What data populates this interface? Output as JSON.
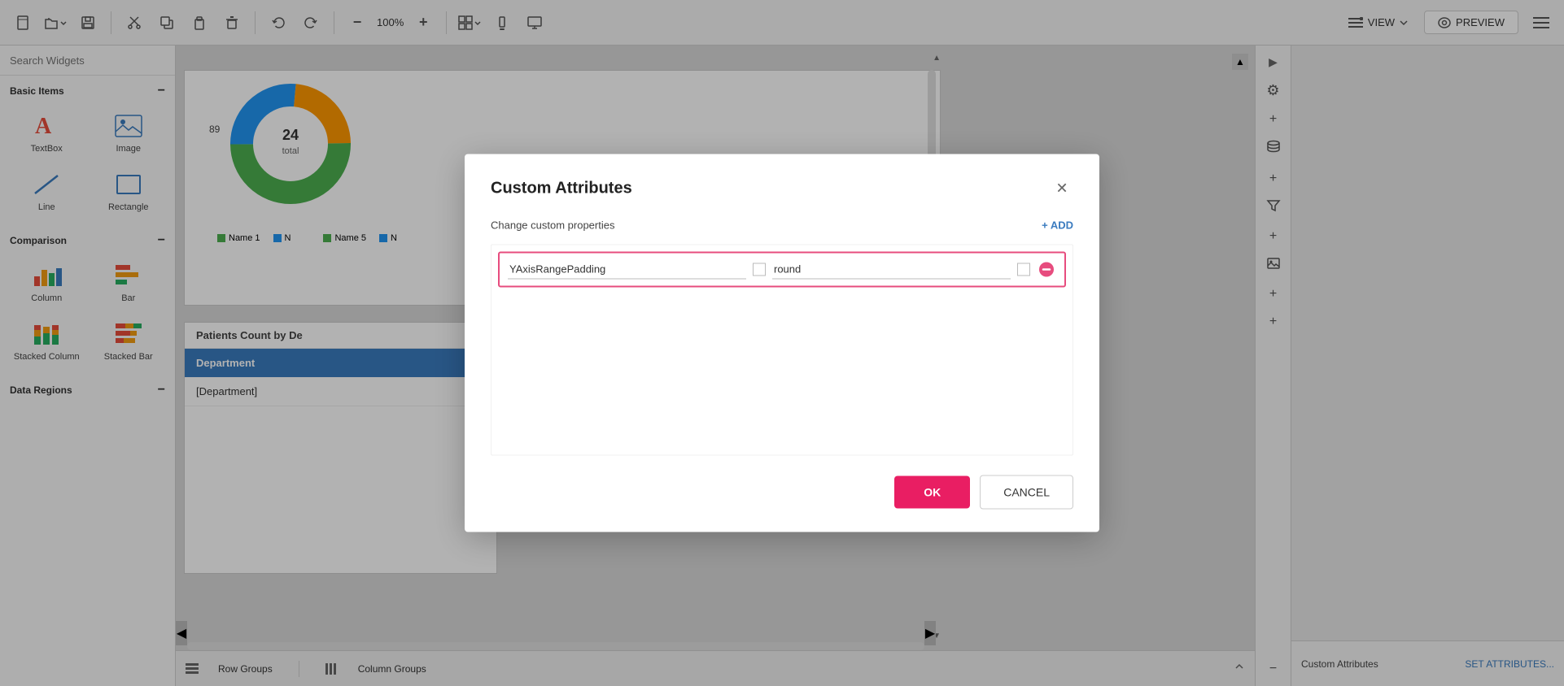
{
  "toolbar": {
    "zoom": "100%",
    "view_label": "VIEW",
    "preview_label": "PREVIEW"
  },
  "sidebar": {
    "search_placeholder": "Search Widgets",
    "sections": [
      {
        "name": "Basic Items",
        "items": [
          {
            "label": "TextBox",
            "icon": "textbox"
          },
          {
            "label": "Image",
            "icon": "image"
          },
          {
            "label": "Line",
            "icon": "line"
          },
          {
            "label": "Rectangle",
            "icon": "rectangle"
          }
        ]
      },
      {
        "name": "Comparison",
        "items": [
          {
            "label": "Column",
            "icon": "column"
          },
          {
            "label": "Bar",
            "icon": "bar"
          },
          {
            "label": "Stacked Column",
            "icon": "stacked-column"
          },
          {
            "label": "Stacked Bar",
            "icon": "stacked-bar"
          }
        ]
      },
      {
        "name": "Data Regions",
        "items": []
      }
    ]
  },
  "canvas": {
    "chart_title": "Patients Count by De",
    "department_header": "Department",
    "department_cell": "[Department]",
    "legend": [
      {
        "label": "Name 1",
        "color": "#4caf50"
      },
      {
        "label": "N",
        "color": "#4caf50"
      },
      {
        "label": "Name 5",
        "color": "#4caf50"
      },
      {
        "label": "N",
        "color": "#4caf50"
      }
    ]
  },
  "bottom_bar": {
    "row_groups": "Row Groups",
    "column_groups": "Column Groups"
  },
  "modal": {
    "title": "Custom Attributes",
    "subtitle": "Change custom properties",
    "add_label": "+ ADD",
    "attribute_name": "YAxisRangePadding",
    "attribute_value": "round",
    "ok_label": "OK",
    "cancel_label": "CANCEL"
  },
  "right_panel": {
    "custom_attributes_label": "Custom Attributes",
    "set_attributes_label": "SET ATTRIBUTES..."
  }
}
